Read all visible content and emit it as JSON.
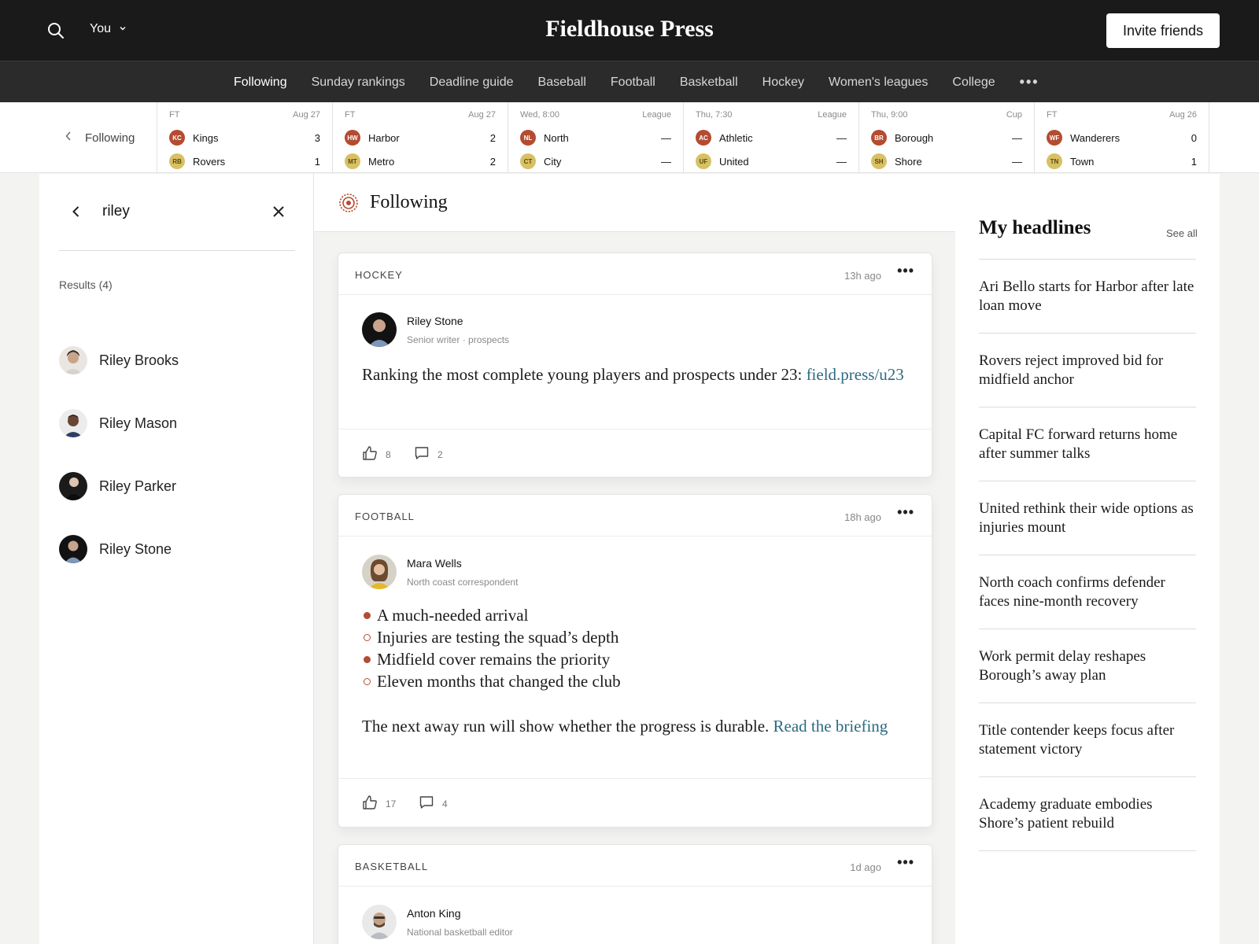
{
  "header": {
    "brand": "Fieldhouse Press",
    "user_menu_label": "You",
    "invite_label": "Invite friends"
  },
  "nav": {
    "items": [
      "Following",
      "Sunday rankings",
      "Deadline guide",
      "Baseball",
      "Football",
      "Basketball",
      "Hockey",
      "Women's leagues",
      "College"
    ],
    "more_label": "•••"
  },
  "scores": {
    "back_label": "Following",
    "games": [
      {
        "status": "FT",
        "info": "Aug 27",
        "home": {
          "abbr": "KC",
          "name": "Kings",
          "score": "3",
          "color": "red"
        },
        "away": {
          "abbr": "RB",
          "name": "Rovers",
          "score": "1",
          "color": "gold"
        }
      },
      {
        "status": "FT",
        "info": "Aug 27",
        "home": {
          "abbr": "HW",
          "name": "Harbor",
          "score": "2",
          "color": "red"
        },
        "away": {
          "abbr": "MT",
          "name": "Metro",
          "score": "2",
          "color": "gold"
        }
      },
      {
        "status": "Wed, 8:00",
        "info": "League",
        "home": {
          "abbr": "NL",
          "name": "North",
          "score": "—",
          "color": "red"
        },
        "away": {
          "abbr": "CT",
          "name": "City",
          "score": "—",
          "color": "gold"
        }
      },
      {
        "status": "Thu, 7:30",
        "info": "League",
        "home": {
          "abbr": "AC",
          "name": "Athletic",
          "score": "—",
          "color": "red"
        },
        "away": {
          "abbr": "UF",
          "name": "United",
          "score": "—",
          "color": "gold"
        }
      },
      {
        "status": "Thu, 9:00",
        "info": "Cup",
        "home": {
          "abbr": "BR",
          "name": "Borough",
          "score": "—",
          "color": "red"
        },
        "away": {
          "abbr": "SH",
          "name": "Shore",
          "score": "—",
          "color": "gold"
        }
      },
      {
        "status": "FT",
        "info": "Aug 26",
        "home": {
          "abbr": "WF",
          "name": "Wanderers",
          "score": "0",
          "color": "red"
        },
        "away": {
          "abbr": "TN",
          "name": "Town",
          "score": "1",
          "color": "gold"
        }
      }
    ]
  },
  "search": {
    "query": "riley",
    "results_label": "Results (4)",
    "results": [
      "Riley Brooks",
      "Riley Mason",
      "Riley Parker",
      "Riley Stone"
    ]
  },
  "feed": {
    "title": "Following",
    "cards": [
      {
        "category": "HOCKEY",
        "time": "13h ago",
        "author": "Riley Stone",
        "role": "Senior writer · prospects",
        "text": "Ranking the most complete young players and prospects under 23:",
        "link": "field.press/u23",
        "likes": "8",
        "comments": "2"
      },
      {
        "category": "FOOTBALL",
        "time": "18h ago",
        "author": "Mara Wells",
        "role": "North coast correspondent",
        "bullets": [
          "A much-needed arrival",
          "Injuries are testing the squad’s depth",
          "Midfield cover remains the priority",
          "Eleven months that changed the club"
        ],
        "text": "The next away run will show whether the progress is durable.",
        "link": "Read the briefing",
        "likes": "17",
        "comments": "4"
      },
      {
        "category": "BASKETBALL",
        "time": "1d ago",
        "author": "Anton King",
        "role": "National basketball editor"
      }
    ]
  },
  "headlines": {
    "title": "My headlines",
    "see_all": "See all",
    "items": [
      "Ari Bello starts for Harbor after late loan move",
      "Rovers reject improved bid for midfield anchor",
      "Capital FC forward returns home after summer talks",
      "United rethink their wide options as injuries mount",
      "North coach confirms defender faces nine-month recovery",
      "Work permit delay reshapes Borough’s away plan",
      "Title contender keeps focus after statement victory",
      "Academy graduate embodies Shore’s patient rebuild"
    ]
  },
  "colors": {
    "accent": "#b44c31",
    "link": "#2d6a80",
    "topbar": "#1a1a1a",
    "navbar": "#2b2b2b",
    "badge_gold": "#d8c064"
  }
}
